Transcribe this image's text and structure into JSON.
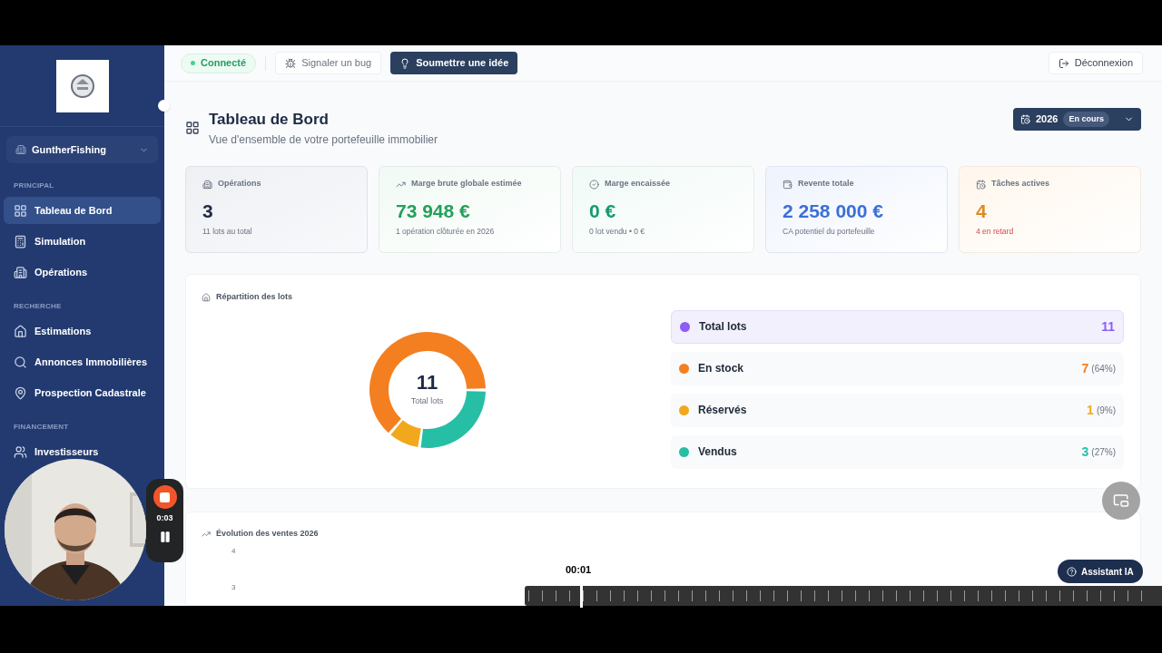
{
  "sidebar": {
    "workspace": "GuntherFishing",
    "sections": [
      {
        "heading": "PRINCIPAL",
        "items": [
          {
            "label": "Tableau de Bord",
            "selected": true
          },
          {
            "label": "Simulation",
            "selected": false
          },
          {
            "label": "Opérations",
            "selected": false
          }
        ]
      },
      {
        "heading": "RECHERCHE",
        "items": [
          {
            "label": "Estimations",
            "selected": false
          },
          {
            "label": "Annonces Immobilières",
            "selected": false
          },
          {
            "label": "Prospection Cadastrale",
            "selected": false
          }
        ]
      },
      {
        "heading": "FINANCEMENT",
        "items": [
          {
            "label": "Investisseurs",
            "selected": false
          }
        ]
      }
    ]
  },
  "topbar": {
    "status": "Connecté",
    "connected": true,
    "buttons": [
      {
        "label": "Signaler un bug",
        "kind": "outline"
      },
      {
        "label": "Soumettre une idée",
        "kind": "primary"
      }
    ],
    "logout": "Déconnexion"
  },
  "header": {
    "title": "Tableau de Bord",
    "subtitle": "Vue d'ensemble de votre portefeuille immobilier",
    "year": "2026",
    "year_badge": "En cours"
  },
  "kpis": [
    {
      "label": "Opérations",
      "value": "3",
      "note": "11 lots au total",
      "color": "#1e2a44"
    },
    {
      "label": "Marge brute globale estimée",
      "value": "73 948 €",
      "note": "1 opération clôturée en 2026",
      "color": "#23a05a"
    },
    {
      "label": "Marge encaissée",
      "value": "0 €",
      "note": "0 lot vendu • 0 €",
      "color": "#169a70"
    },
    {
      "label": "Revente totale",
      "value": "2 258 000 €",
      "note": "CA potentiel du portefeuille",
      "color": "#3b6fd6"
    },
    {
      "label": "Tâches actives",
      "value": "4",
      "note": "4 en retard",
      "color": "#e08a1f"
    }
  ],
  "distribution": {
    "title": "Répartition des lots",
    "center_value": "11",
    "center_label": "Total lots",
    "rows": [
      {
        "kind": "total",
        "label": "Total lots",
        "count": "11",
        "color": "#8b5cf6"
      },
      {
        "kind": "part",
        "label": "En stock",
        "count": "7",
        "percent": "(64%)",
        "color": "#f47f20"
      },
      {
        "kind": "part",
        "label": "Réservés",
        "count": "1",
        "percent": "(9%)",
        "color": "#f2a81d"
      },
      {
        "kind": "part",
        "label": "Vendus",
        "count": "3",
        "percent": "(27%)",
        "color": "#26bfa5"
      }
    ]
  },
  "sales_chart": {
    "title": "Évolution des ventes 2026",
    "y_labels": [
      "4",
      "3"
    ]
  },
  "recorder": {
    "time": "0:03",
    "playhead_time": "00:01"
  },
  "assistant": {
    "label": "Assistant IA"
  }
}
